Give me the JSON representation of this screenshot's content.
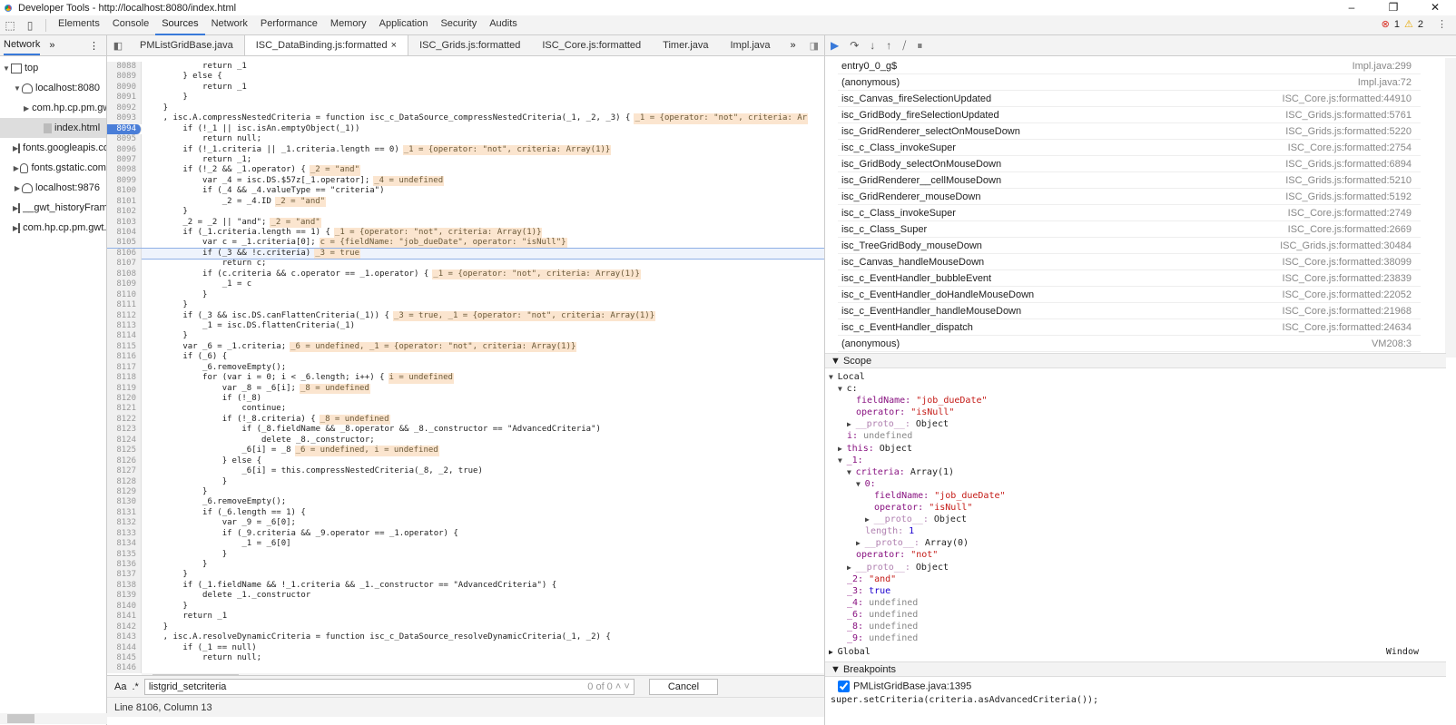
{
  "window": {
    "title": "Developer Tools - http://localhost:8080/index.html",
    "minimize": "–",
    "restore": "❐",
    "close": "✕"
  },
  "main_tabs": [
    "Elements",
    "Console",
    "Sources",
    "Network",
    "Performance",
    "Memory",
    "Application",
    "Security",
    "Audits"
  ],
  "active_main_tab": "Sources",
  "status_counts": {
    "errors": "1",
    "warnings": "2"
  },
  "navigator": {
    "tab": "Network",
    "more": "»",
    "menu": "⋮",
    "items": [
      {
        "label": "top",
        "depth": 0,
        "arrow": "▼",
        "icon": "frame"
      },
      {
        "label": "localhost:8080",
        "depth": 1,
        "arrow": "▼",
        "icon": "cloud"
      },
      {
        "label": "com.hp.cp.pm.gwt",
        "depth": 2,
        "arrow": "▶",
        "icon": "folder"
      },
      {
        "label": "index.html",
        "depth": 3,
        "arrow": "",
        "icon": "file",
        "selected": true
      },
      {
        "label": "fonts.googleapis.com",
        "depth": 1,
        "arrow": "▶",
        "icon": "cloud"
      },
      {
        "label": "fonts.gstatic.com",
        "depth": 1,
        "arrow": "▶",
        "icon": "cloud"
      },
      {
        "label": "localhost:9876",
        "depth": 1,
        "arrow": "▶",
        "icon": "cloud"
      },
      {
        "label": "__gwt_historyFrame",
        "depth": 1,
        "arrow": "▶",
        "icon": "frame"
      },
      {
        "label": "com.hp.cp.pm.gwt.",
        "depth": 1,
        "arrow": "▶",
        "icon": "frame"
      }
    ]
  },
  "file_tabs": [
    {
      "label": "PMListGridBase.java"
    },
    {
      "label": "ISC_DataBinding.js:formatted",
      "active": true,
      "close": "×"
    },
    {
      "label": "ISC_Grids.js:formatted"
    },
    {
      "label": "ISC_Core.js:formatted"
    },
    {
      "label": "Timer.java"
    },
    {
      "label": "Impl.java"
    }
  ],
  "file_tabs_more": "»",
  "code": {
    "breakpoint_line": 8094,
    "current_line": 8106,
    "lines": [
      {
        "n": 8088,
        "t": "            return _1"
      },
      {
        "n": 8089,
        "t": "        } else {"
      },
      {
        "n": 8090,
        "t": "            return _1"
      },
      {
        "n": 8091,
        "t": "        }"
      },
      {
        "n": 8092,
        "t": "    }"
      },
      {
        "n": 8093,
        "t": "    , isc.A.compressNestedCriteria = function isc_c_DataSource_compressNestedCriteria(_1, _2, _3) {",
        "v": "_1 = {operator: \"not\", criteria: Ar"
      },
      {
        "n": 8094,
        "t": "        if (!_1 || isc.isAn.emptyObject(_1))"
      },
      {
        "n": 8095,
        "t": "            return null;"
      },
      {
        "n": 8096,
        "t": "        if (!_1.criteria || _1.criteria.length == 0)",
        "v": "_1 = {operator: \"not\", criteria: Array(1)}"
      },
      {
        "n": 8097,
        "t": "            return _1;"
      },
      {
        "n": 8098,
        "t": "        if (!_2 && _1.operator) {",
        "v": "_2 = \"and\""
      },
      {
        "n": 8099,
        "t": "            var _4 = isc.DS.$57z[_1.operator];",
        "v": "_4 = undefined"
      },
      {
        "n": 8100,
        "t": "            if (_4 && _4.valueType == \"criteria\")"
      },
      {
        "n": 8101,
        "t": "                _2 = _4.ID",
        "v": "_2 = \"and\""
      },
      {
        "n": 8102,
        "t": "        }"
      },
      {
        "n": 8103,
        "t": "        _2 = _2 || \"and\";",
        "v": "_2 = \"and\""
      },
      {
        "n": 8104,
        "t": "        if (_1.criteria.length == 1) {",
        "v": "_1 = {operator: \"not\", criteria: Array(1)}"
      },
      {
        "n": 8105,
        "t": "            var c = _1.criteria[0];",
        "v": "c = {fieldName: \"job_dueDate\", operator: \"isNull\"}"
      },
      {
        "n": 8106,
        "t": "            if (_3 && !c.criteria)",
        "v": "_3 = true"
      },
      {
        "n": 8107,
        "t": "                return c;"
      },
      {
        "n": 8108,
        "t": "            if (c.criteria && c.operator == _1.operator) {",
        "v": "_1 = {operator: \"not\", criteria: Array(1)}"
      },
      {
        "n": 8109,
        "t": "                _1 = c"
      },
      {
        "n": 8110,
        "t": "            }"
      },
      {
        "n": 8111,
        "t": "        }"
      },
      {
        "n": 8112,
        "t": "        if (_3 && isc.DS.canFlattenCriteria(_1)) {",
        "v": "_3 = true, _1 = {operator: \"not\", criteria: Array(1)}"
      },
      {
        "n": 8113,
        "t": "            _1 = isc.DS.flattenCriteria(_1)"
      },
      {
        "n": 8114,
        "t": "        }"
      },
      {
        "n": 8115,
        "t": "        var _6 = _1.criteria;",
        "v": "_6 = undefined, _1 = {operator: \"not\", criteria: Array(1)}"
      },
      {
        "n": 8116,
        "t": "        if (_6) {"
      },
      {
        "n": 8117,
        "t": "            _6.removeEmpty();"
      },
      {
        "n": 8118,
        "t": "            for (var i = 0; i < _6.length; i++) {",
        "v": "i = undefined"
      },
      {
        "n": 8119,
        "t": "                var _8 = _6[i];",
        "v": "_8 = undefined"
      },
      {
        "n": 8120,
        "t": "                if (!_8)"
      },
      {
        "n": 8121,
        "t": "                    continue;"
      },
      {
        "n": 8122,
        "t": "                if (!_8.criteria) {",
        "v": "_8 = undefined"
      },
      {
        "n": 8123,
        "t": "                    if (_8.fieldName && _8.operator && _8._constructor == \"AdvancedCriteria\")"
      },
      {
        "n": 8124,
        "t": "                        delete _8._constructor;"
      },
      {
        "n": 8125,
        "t": "                    _6[i] = _8",
        "v": "_6 = undefined, i = undefined"
      },
      {
        "n": 8126,
        "t": "                } else {"
      },
      {
        "n": 8127,
        "t": "                    _6[i] = this.compressNestedCriteria(_8, _2, true)"
      },
      {
        "n": 8128,
        "t": "                }"
      },
      {
        "n": 8129,
        "t": "            }"
      },
      {
        "n": 8130,
        "t": "            _6.removeEmpty();"
      },
      {
        "n": 8131,
        "t": "            if (_6.length == 1) {"
      },
      {
        "n": 8132,
        "t": "                var _9 = _6[0];"
      },
      {
        "n": 8133,
        "t": "                if (_9.criteria && _9.operator == _1.operator) {"
      },
      {
        "n": 8134,
        "t": "                    _1 = _6[0]"
      },
      {
        "n": 8135,
        "t": "                }"
      },
      {
        "n": 8136,
        "t": "            }"
      },
      {
        "n": 8137,
        "t": "        }"
      },
      {
        "n": 8138,
        "t": "        if (_1.fieldName && !_1.criteria && _1._constructor == \"AdvancedCriteria\") {"
      },
      {
        "n": 8139,
        "t": "            delete _1._constructor"
      },
      {
        "n": 8140,
        "t": "        }"
      },
      {
        "n": 8141,
        "t": "        return _1"
      },
      {
        "n": 8142,
        "t": "    }"
      },
      {
        "n": 8143,
        "t": "    , isc.A.resolveDynamicCriteria = function isc_c_DataSource_resolveDynamicCriteria(_1, _2) {"
      },
      {
        "n": 8144,
        "t": "        if (_1 == null)"
      },
      {
        "n": 8145,
        "t": "            return null;"
      },
      {
        "n": 8146,
        "t": ""
      }
    ]
  },
  "search": {
    "match_case": "Aa",
    "regex": ".*",
    "value": "listgrid_setcriteria",
    "count": "0 of 0",
    "up": "˄",
    "down": "˅",
    "cancel": "Cancel"
  },
  "status_bar": "Line 8106, Column 13",
  "debugger_toolbar": [
    "resume",
    "step-over",
    "step-into",
    "step-out",
    "deactivate-breakpoints",
    "pause-on-exceptions"
  ],
  "call_stack": [
    {
      "fn": "entry0_0_g$",
      "loc": "Impl.java:299"
    },
    {
      "fn": "(anonymous)",
      "loc": "Impl.java:72"
    },
    {
      "fn": "isc_Canvas_fireSelectionUpdated",
      "loc": "ISC_Core.js:formatted:44910"
    },
    {
      "fn": "isc_GridBody_fireSelectionUpdated",
      "loc": "ISC_Grids.js:formatted:5761"
    },
    {
      "fn": "isc_GridRenderer_selectOnMouseDown",
      "loc": "ISC_Grids.js:formatted:5220"
    },
    {
      "fn": "isc_c_Class_invokeSuper",
      "loc": "ISC_Core.js:formatted:2754"
    },
    {
      "fn": "isc_GridBody_selectOnMouseDown",
      "loc": "ISC_Grids.js:formatted:6894"
    },
    {
      "fn": "isc_GridRenderer__cellMouseDown",
      "loc": "ISC_Grids.js:formatted:5210"
    },
    {
      "fn": "isc_GridRenderer_mouseDown",
      "loc": "ISC_Grids.js:formatted:5192"
    },
    {
      "fn": "isc_c_Class_invokeSuper",
      "loc": "ISC_Core.js:formatted:2749"
    },
    {
      "fn": "isc_c_Class_Super",
      "loc": "ISC_Core.js:formatted:2669"
    },
    {
      "fn": "isc_TreeGridBody_mouseDown",
      "loc": "ISC_Grids.js:formatted:30484"
    },
    {
      "fn": "isc_Canvas_handleMouseDown",
      "loc": "ISC_Core.js:formatted:38099"
    },
    {
      "fn": "isc_c_EventHandler_bubbleEvent",
      "loc": "ISC_Core.js:formatted:23839"
    },
    {
      "fn": "isc_c_EventHandler_doHandleMouseDown",
      "loc": "ISC_Core.js:formatted:22052"
    },
    {
      "fn": "isc_c_EventHandler_handleMouseDown",
      "loc": "ISC_Core.js:formatted:21968"
    },
    {
      "fn": "isc_c_EventHandler_dispatch",
      "loc": "ISC_Core.js:formatted:24634"
    },
    {
      "fn": "(anonymous)",
      "loc": "VM208:3"
    }
  ],
  "scope": {
    "title": "Scope",
    "rows": [
      {
        "d": 0,
        "a": "▼",
        "k": "Local",
        "kc": "pl"
      },
      {
        "d": 1,
        "a": "▼",
        "k": "c:",
        "kc": "pl"
      },
      {
        "d": 2,
        "k": "fieldName: ",
        "v": "\"job_dueDate\"",
        "vc": "s"
      },
      {
        "d": 2,
        "k": "operator: ",
        "v": "\"isNull\"",
        "vc": "s"
      },
      {
        "d": 2,
        "a": "▶",
        "k": "__proto__: ",
        "kc": "dim",
        "v": "Object",
        "vc": "o"
      },
      {
        "d": 1,
        "k": "i: ",
        "v": "undefined",
        "vc": "u"
      },
      {
        "d": 1,
        "a": "▶",
        "k": "this: ",
        "v": "Object",
        "vc": "o"
      },
      {
        "d": 1,
        "a": "▼",
        "k": "_1:"
      },
      {
        "d": 2,
        "a": "▼",
        "k": "criteria: ",
        "v": "Array(1)",
        "vc": "o"
      },
      {
        "d": 3,
        "a": "▼",
        "k": "0:"
      },
      {
        "d": 4,
        "k": "fieldName: ",
        "v": "\"job_dueDate\"",
        "vc": "s"
      },
      {
        "d": 4,
        "k": "operator: ",
        "v": "\"isNull\"",
        "vc": "s"
      },
      {
        "d": 4,
        "a": "▶",
        "k": "__proto__: ",
        "kc": "dim",
        "v": "Object",
        "vc": "o"
      },
      {
        "d": 3,
        "k": "length: ",
        "kc": "dim",
        "v": "1",
        "vc": "b"
      },
      {
        "d": 3,
        "a": "▶",
        "k": "__proto__: ",
        "kc": "dim",
        "v": "Array(0)",
        "vc": "o"
      },
      {
        "d": 2,
        "k": "operator: ",
        "v": "\"not\"",
        "vc": "s"
      },
      {
        "d": 2,
        "a": "▶",
        "k": "__proto__: ",
        "kc": "dim",
        "v": "Object",
        "vc": "o"
      },
      {
        "d": 1,
        "k": "_2: ",
        "v": "\"and\"",
        "vc": "s"
      },
      {
        "d": 1,
        "k": "_3: ",
        "v": "true",
        "vc": "b"
      },
      {
        "d": 1,
        "k": "_4: ",
        "v": "undefined",
        "vc": "u"
      },
      {
        "d": 1,
        "k": "_6: ",
        "v": "undefined",
        "vc": "u"
      },
      {
        "d": 1,
        "k": "_8: ",
        "v": "undefined",
        "vc": "u"
      },
      {
        "d": 1,
        "k": "_9: ",
        "v": "undefined",
        "vc": "u"
      }
    ],
    "global": "Global",
    "global_value": "Window"
  },
  "breakpoints": {
    "title": "Breakpoints",
    "items": [
      {
        "label": "PMListGridBase.java:1395",
        "checked": true,
        "code": "super.setCriteria(criteria.asAdvancedCriteria());"
      }
    ]
  },
  "colors": {
    "accent": "#3879d9",
    "breakpoint": "#4a7ed8",
    "inline_value_bg": "#fbe5cf",
    "error": "#d93025",
    "warning": "#e6a700"
  }
}
